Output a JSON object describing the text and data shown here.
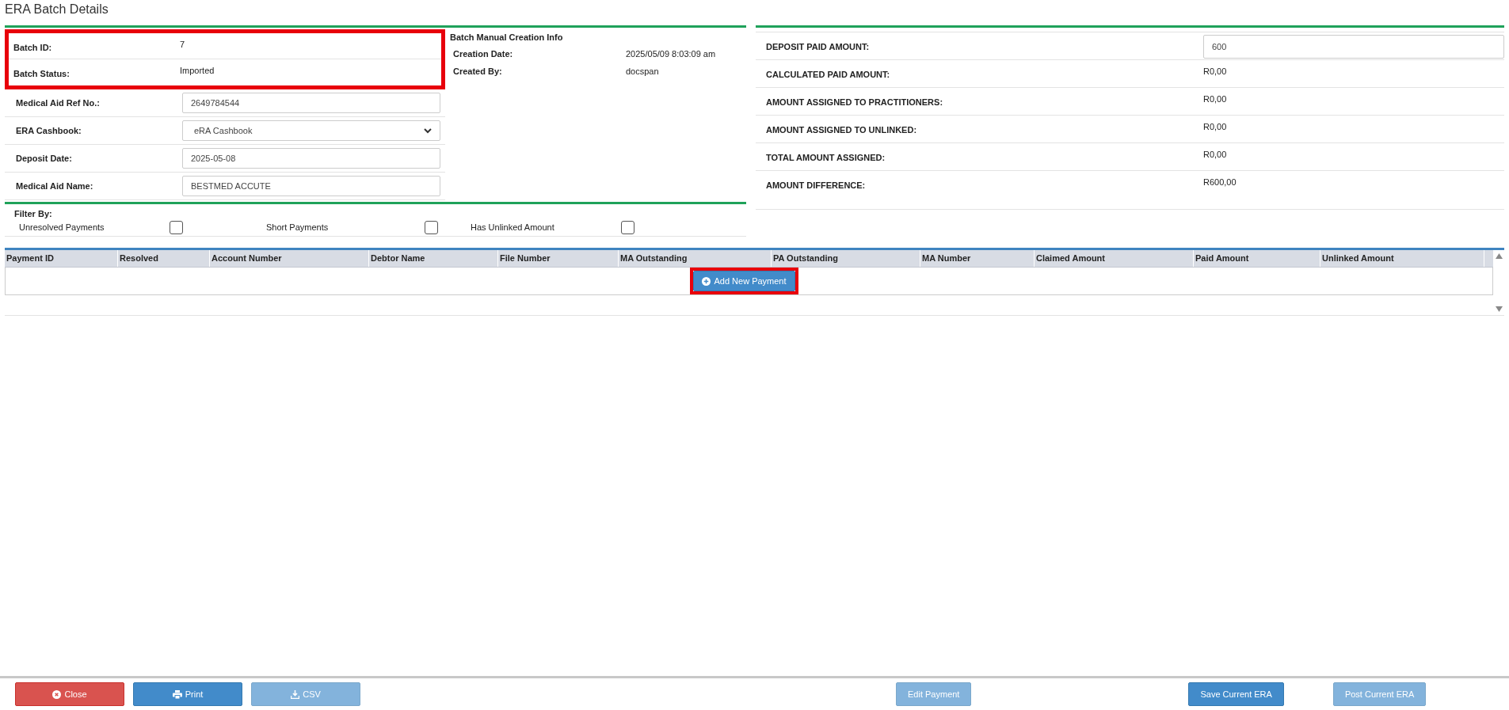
{
  "page_title": "ERA Batch Details",
  "batch_info": {
    "highlighted": true,
    "rows": [
      {
        "label": "Batch ID:",
        "value": "7"
      },
      {
        "label": "Batch Status:",
        "value": "Imported"
      }
    ]
  },
  "batch_fields": [
    {
      "kind": "input",
      "label": "Medical Aid Ref No.:",
      "value": "2649784544"
    },
    {
      "kind": "select",
      "label": "ERA Cashbook:",
      "value": "eRA Cashbook"
    },
    {
      "kind": "input",
      "label": "Deposit Date:",
      "value": "2025-05-08"
    },
    {
      "kind": "input",
      "label": "Medical Aid Name:",
      "value": "BESTMED ACCUTE"
    }
  ],
  "creation_info": {
    "title": "Batch Manual Creation Info",
    "rows": [
      {
        "label": "Creation Date:",
        "value": "2025/05/09 8:03:09 am"
      },
      {
        "label": "Created By:",
        "value": "docspan"
      }
    ]
  },
  "filter": {
    "title": "Filter By:",
    "options": [
      {
        "label": "Unresolved Payments",
        "checked": false
      },
      {
        "label": "Short Payments",
        "checked": false
      },
      {
        "label": "Has Unlinked Amount",
        "checked": false
      }
    ]
  },
  "amounts": [
    {
      "kind": "input",
      "label": "DEPOSIT PAID AMOUNT:",
      "value": "600"
    },
    {
      "kind": "text",
      "label": "CALCULATED PAID AMOUNT:",
      "value": "R0,00"
    },
    {
      "kind": "text",
      "label": "AMOUNT ASSIGNED TO PRACTITIONERS:",
      "value": "R0,00"
    },
    {
      "kind": "text",
      "label": "AMOUNT ASSIGNED TO UNLINKED:",
      "value": "R0,00"
    },
    {
      "kind": "text",
      "label": "TOTAL AMOUNT ASSIGNED:",
      "value": "R0,00"
    },
    {
      "kind": "text",
      "label": "AMOUNT DIFFERENCE:",
      "value": "R600,00"
    }
  ],
  "table": {
    "columns": [
      "Payment ID",
      "Resolved",
      "Account Number",
      "Debtor Name",
      "File Number",
      "MA Outstanding",
      "PA Outstanding",
      "MA Number",
      "Claimed Amount",
      "Paid Amount",
      "Unlinked Amount"
    ],
    "add_button": {
      "label": "Add New Payment",
      "highlighted": true
    }
  },
  "footer_buttons": [
    {
      "kind": "close",
      "label": "Close",
      "disabled": false
    },
    {
      "kind": "print",
      "label": "Print",
      "disabled": false
    },
    {
      "kind": "csv",
      "label": "CSV",
      "disabled": true
    },
    {
      "kind": "plain",
      "label": "Edit Payment",
      "disabled": true
    },
    {
      "kind": "plain",
      "label": "Save Current ERA",
      "disabled": false
    },
    {
      "kind": "plain",
      "label": "Post Current ERA",
      "disabled": true
    }
  ]
}
